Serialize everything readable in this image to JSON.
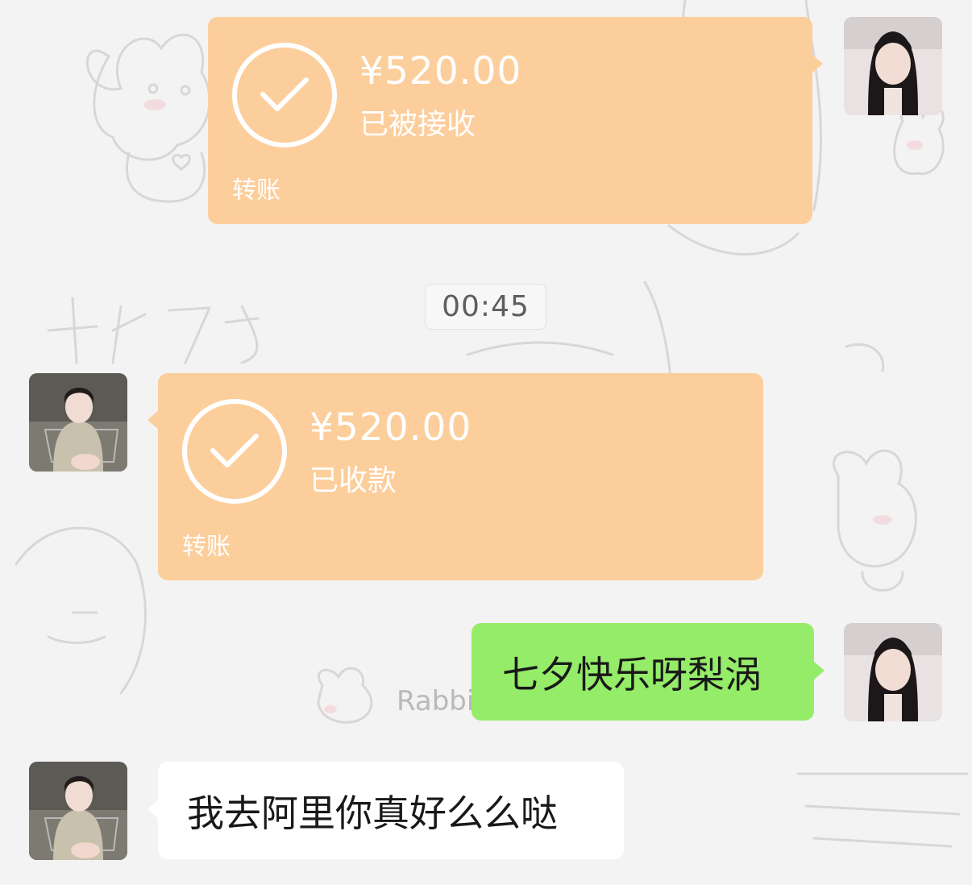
{
  "conversation": {
    "messages": [
      {
        "type": "transfer",
        "side": "sent",
        "amount": "¥520.00",
        "status": "已被接收",
        "label": "转账"
      },
      {
        "type": "timestamp",
        "text": "00:45"
      },
      {
        "type": "transfer",
        "side": "received",
        "amount": "¥520.00",
        "status": "已收款",
        "label": "转账"
      },
      {
        "type": "text",
        "side": "sent",
        "text": "七夕快乐呀梨涡"
      },
      {
        "type": "text",
        "side": "received",
        "text": "我去阿里你真好么么哒"
      }
    ]
  },
  "background": {
    "watermark_text": "Rabbi"
  },
  "colors": {
    "transfer_bubble": "#fcce9c",
    "sent_bubble": "#95ec69",
    "received_bubble": "#ffffff",
    "chat_background": "#f4f3f3"
  },
  "icons": {
    "transfer_status": "check-circle-icon"
  }
}
